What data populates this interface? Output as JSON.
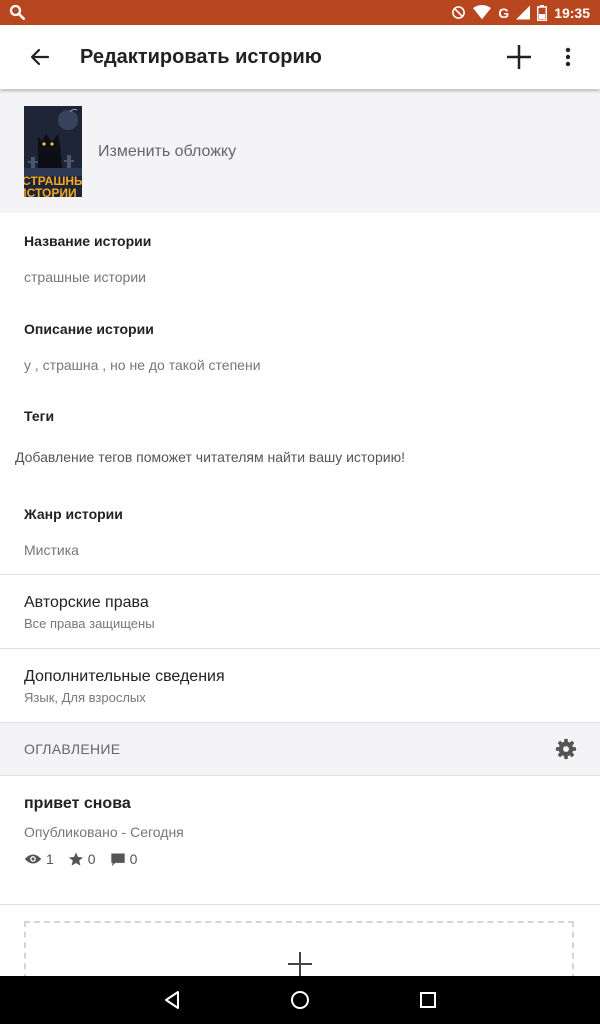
{
  "status_bar": {
    "network": "G",
    "time": "19:35"
  },
  "app_bar": {
    "title": "Редактировать историю"
  },
  "cover": {
    "change_label": "Изменить обложку",
    "art_text_line1": "СТРАШНЫ",
    "art_text_line2": "ИСТОРИИ"
  },
  "fields": {
    "title_label": "Название истории",
    "title_value": "страшные истории",
    "description_label": "Описание истории",
    "description_value": "у , страшна , но не до такой степени",
    "tags_label": "Теги",
    "tags_hint": "Добавление тегов поможет читателям найти вашу историю!",
    "genre_label": "Жанр истории",
    "genre_value": "Мистика"
  },
  "rows": {
    "copyright_title": "Авторские права",
    "copyright_sub": "Все права защищены",
    "details_title": "Дополнительные сведения",
    "details_sub": "Язык, Для взрослых"
  },
  "toc": {
    "header": "ОГЛАВЛЕНИЕ",
    "parts": [
      {
        "title": "привет снова",
        "status": "Опубликовано - Сегодня",
        "views": "1",
        "votes": "0",
        "comments": "0"
      }
    ]
  },
  "colors": {
    "status_bar": "#b8461e",
    "section_bg": "#f4f3f6",
    "cover_bg": "#1d2536",
    "cover_text": "#f5a623"
  },
  "icons": {
    "back": "arrow-left-icon",
    "add": "plus-icon",
    "more": "more-vert-icon",
    "settings": "gear-icon",
    "views": "eye-icon",
    "votes": "star-icon",
    "comments": "comment-icon"
  }
}
